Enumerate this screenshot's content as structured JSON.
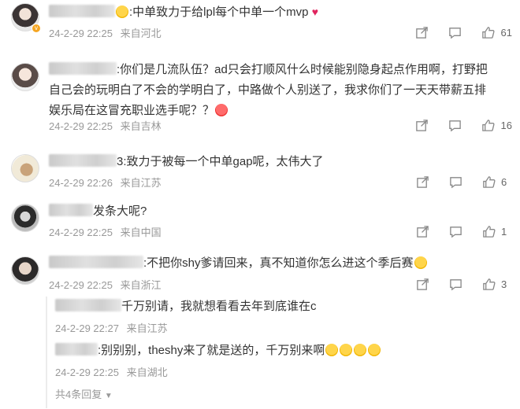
{
  "comments": [
    {
      "text": ":中单致力于给lpl每个中单一个mvp",
      "date": "24-2-29 22:25",
      "location": "来自河北",
      "likes": "61"
    },
    {
      "text": ":你们是几流队伍？ad只会打顺风什么时候能别隐身起点作用啊，打野把自己会的玩明白了不会的学明白了，中路做个人别送了，我求你们了一天天带薪五排娱乐局在这冒充职业选手呢？？",
      "date": "24-2-29 22:25",
      "location": "来自吉林",
      "likes": "16"
    },
    {
      "text": "3:致力于被每一个中单gap呢，太伟大了",
      "date": "24-2-29 22:26",
      "location": "来自江苏",
      "likes": "6"
    },
    {
      "text": "发条大呢?",
      "date": "24-2-29 22:25",
      "location": "来自中国",
      "likes": "1"
    },
    {
      "text": ":不把你shy爹请回来，真不知道你怎么进这个季后赛",
      "date": "24-2-29 22:25",
      "location": "来自浙江",
      "likes": "3"
    }
  ],
  "replies": [
    {
      "text": "千万别请，我就想看看去年到底谁在c",
      "date": "24-2-29 22:27",
      "location": "来自江苏"
    },
    {
      "text": ":别别别，theshy来了就是送的，千万别来啊",
      "date": "24-2-29 22:25",
      "location": "来自湖北"
    }
  ],
  "more_replies": "共4条回复",
  "icons": {
    "share": "share-icon",
    "comment": "comment-icon",
    "like": "thumbs-up-icon",
    "more": "chevron-down-icon"
  }
}
